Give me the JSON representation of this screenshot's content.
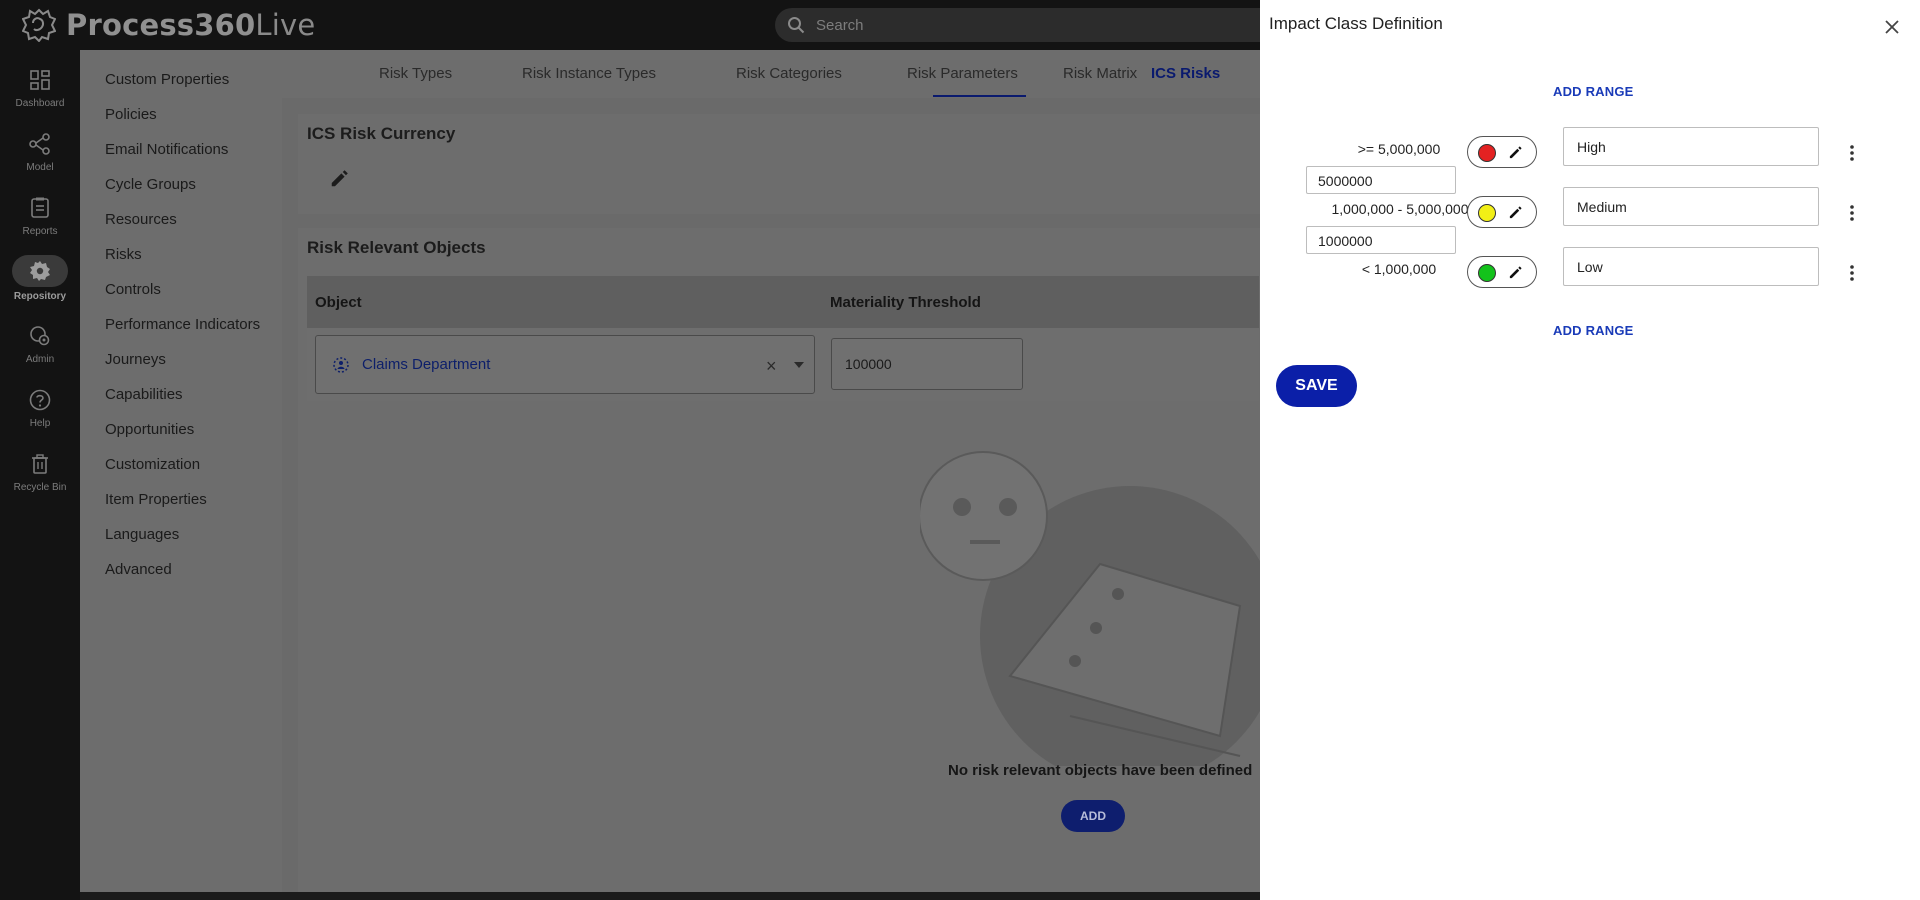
{
  "app": {
    "brand_bold": "Process360",
    "brand_light": "Live",
    "search_placeholder": "Search"
  },
  "leftnav": [
    {
      "label": "Dashboard",
      "icon": "dashboard-icon"
    },
    {
      "label": "Model",
      "icon": "model-icon"
    },
    {
      "label": "Reports",
      "icon": "reports-icon"
    },
    {
      "label": "Repository",
      "icon": "gear-icon",
      "active": true
    },
    {
      "label": "Admin",
      "icon": "admin-icon"
    },
    {
      "label": "Help",
      "icon": "help-icon"
    },
    {
      "label": "Recycle Bin",
      "icon": "trash-icon"
    }
  ],
  "settings_menu": [
    "Custom Properties",
    "Policies",
    "Email Notifications",
    "Cycle Groups",
    "Resources",
    "Risks",
    "Controls",
    "Performance Indicators",
    "Journeys",
    "Capabilities",
    "Opportunities",
    "Customization",
    "Item Properties",
    "Languages",
    "Advanced"
  ],
  "tabs": [
    {
      "label": "Risk Types"
    },
    {
      "label": "Risk Instance Types"
    },
    {
      "label": "Risk Categories"
    },
    {
      "label": "Risk Parameters"
    },
    {
      "label": "Risk Matrix"
    },
    {
      "label": "ICS Risks",
      "active": true
    }
  ],
  "currency_card": {
    "title": "ICS Risk Currency"
  },
  "objects_card": {
    "title": "Risk Relevant Objects",
    "columns": [
      "Object",
      "Materiality Threshold"
    ],
    "rows": [
      {
        "object": "Claims Department",
        "threshold": "100000"
      }
    ],
    "empty_message": "No risk relevant objects have been defined",
    "add_label": "ADD"
  },
  "dialog": {
    "title": "Impact Class Definition",
    "add_range_label": "ADD RANGE",
    "save_label": "SAVE",
    "ranges": [
      {
        "range_label": ">= 5,000,000",
        "color": "#e32222",
        "name": "High"
      },
      {
        "range_label": "1,000,000 - 5,000,000",
        "color": "#f2ef16",
        "name": "Medium"
      },
      {
        "range_label": "< 1,000,000",
        "color": "#13c21b",
        "name": "Low"
      }
    ],
    "boundaries": [
      "5000000",
      "1000000"
    ]
  },
  "colors": {
    "accent": "#0b1fa8",
    "tab_active": "#0a1a6e"
  }
}
